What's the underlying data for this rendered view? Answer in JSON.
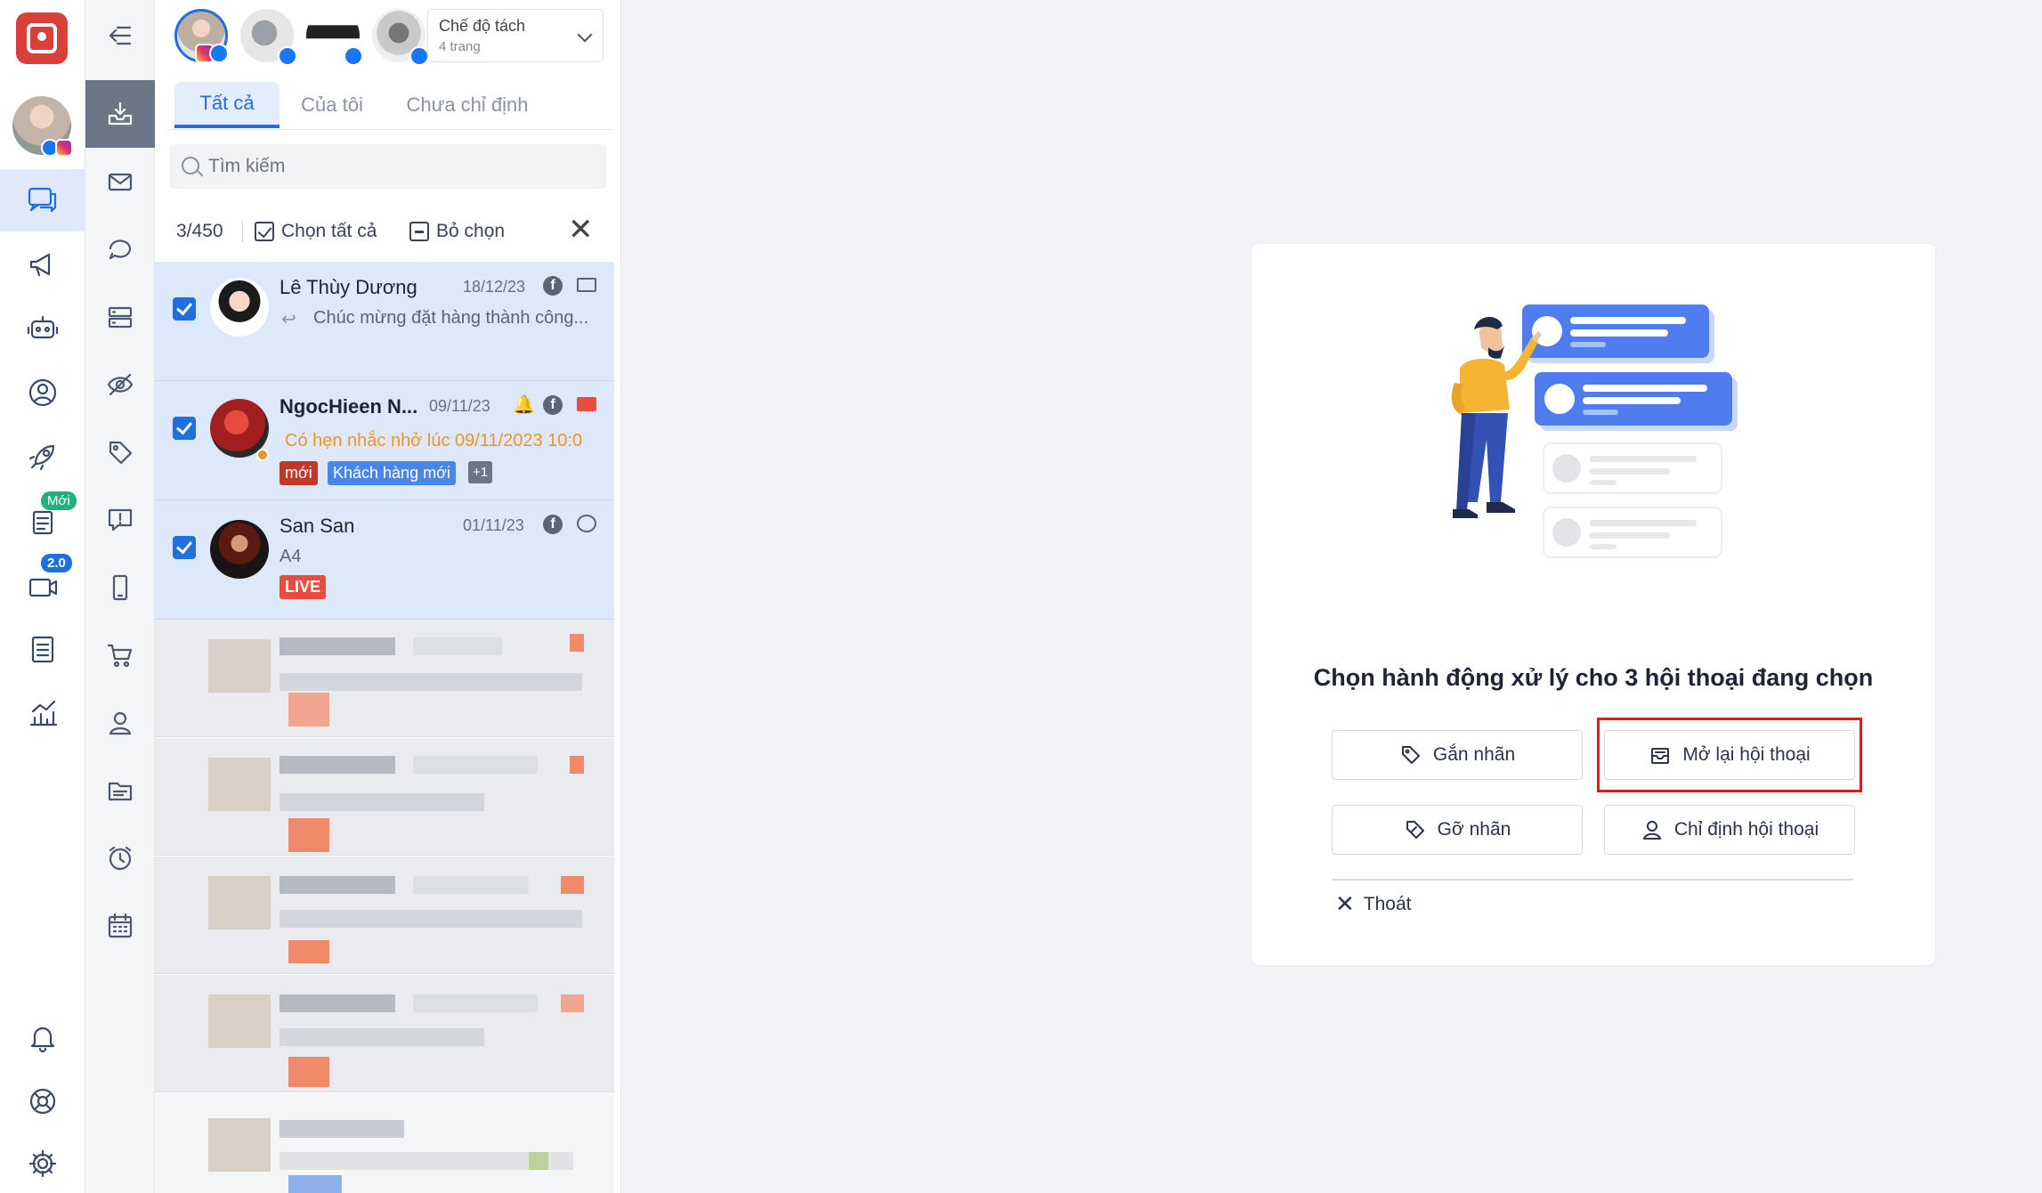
{
  "header": {
    "mode_title": "Chế độ tách",
    "mode_subtitle": "4 trang"
  },
  "tabs": [
    {
      "label": "Tất cả",
      "active": true
    },
    {
      "label": "Của tôi",
      "active": false
    },
    {
      "label": "Chưa chỉ định",
      "active": false
    }
  ],
  "search": {
    "placeholder": "Tìm kiếm"
  },
  "selection": {
    "count": "3/450",
    "select_all": "Chọn tất cả",
    "deselect": "Bỏ chọn"
  },
  "sidebar": {
    "badge_new": "Mới",
    "badge_version": "2.0"
  },
  "conversations": [
    {
      "name": "Lê Thùy Dương",
      "date": "18/12/23",
      "preview": "Chúc mừng đặt hàng thành công...",
      "checked": true
    },
    {
      "name": "NgocHieen N...",
      "date": "09/11/23",
      "preview": "Có hẹn nhắc nhở lúc 09/11/2023 10:0",
      "tags": [
        "mới",
        "Khách hàng mới",
        "+1"
      ],
      "checked": true
    },
    {
      "name": "San San",
      "date": "01/11/23",
      "preview": "A4",
      "tags": [
        "LIVE"
      ],
      "checked": true
    }
  ],
  "modal": {
    "title": "Chọn hành động xử lý cho 3 hội thoại đang chọn",
    "buttons": {
      "add_tag": "Gắn nhãn",
      "reopen": "Mở lại hội thoại",
      "remove_tag": "Gỡ nhãn",
      "assign": "Chỉ định hội thoại"
    },
    "exit": "Thoát"
  },
  "colors": {
    "accent": "#1f6fe0",
    "highlight": "#e01b1b",
    "reminder": "#f0932b",
    "tag_red": "#c0392b",
    "tag_blue": "#4a86e8",
    "tag_gray": "#6b7586",
    "live": "#e74c3c"
  }
}
